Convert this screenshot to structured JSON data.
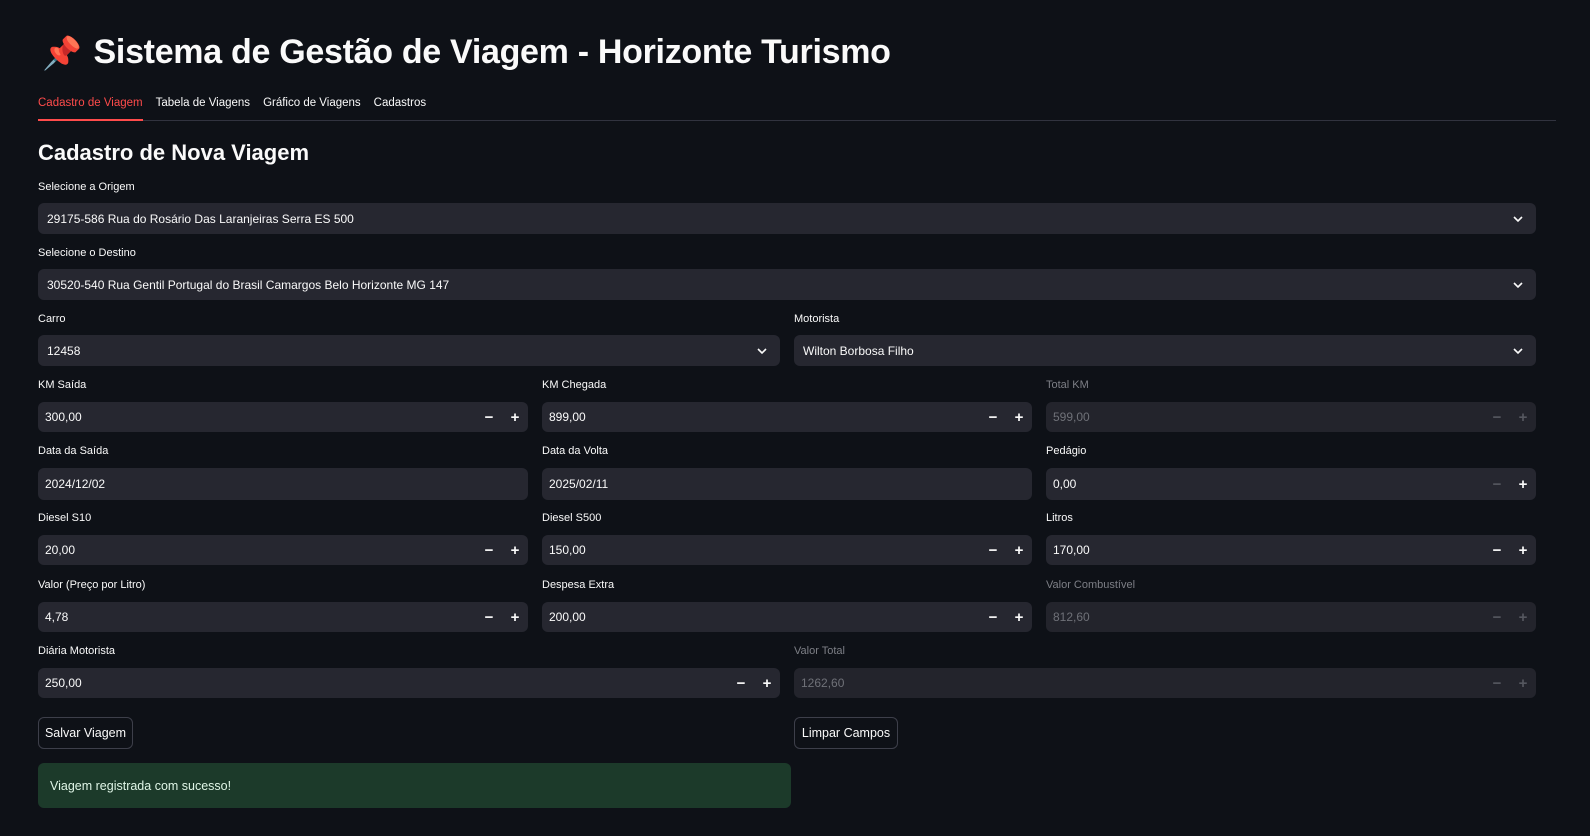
{
  "app": {
    "title_icon": "pushpin-icon",
    "title": "Sistema de Gestão de Viagem - Horizonte Turismo"
  },
  "tabs": [
    {
      "label": "Cadastro de Viagem",
      "active": true
    },
    {
      "label": "Tabela de Viagens",
      "active": false
    },
    {
      "label": "Gráfico de Viagens",
      "active": false
    },
    {
      "label": "Cadastros",
      "active": false
    }
  ],
  "form": {
    "heading": "Cadastro de Nova Viagem",
    "origem": {
      "label": "Selecione a Origem",
      "value": "29175-586 Rua do Rosário Das Laranjeiras Serra ES 500"
    },
    "destino": {
      "label": "Selecione o Destino",
      "value": "30520-540 Rua Gentil Portugal do Brasil Camargos Belo Horizonte MG 147"
    },
    "carro": {
      "label": "Carro",
      "value": "12458"
    },
    "motorista": {
      "label": "Motorista",
      "value": "Wilton Borbosa Filho"
    },
    "km_saida": {
      "label": "KM Saída",
      "value": "300,00"
    },
    "km_chegada": {
      "label": "KM Chegada",
      "value": "899,00"
    },
    "total_km": {
      "label": "Total KM",
      "value": "599,00",
      "disabled": true
    },
    "data_saida": {
      "label": "Data da Saída",
      "value": "2024/12/02"
    },
    "data_volta": {
      "label": "Data da Volta",
      "value": "2025/02/11"
    },
    "pedagio": {
      "label": "Pedágio",
      "value": "0,00"
    },
    "diesel_s10": {
      "label": "Diesel S10",
      "value": "20,00"
    },
    "diesel_s500": {
      "label": "Diesel S500",
      "value": "150,00"
    },
    "litros": {
      "label": "Litros",
      "value": "170,00"
    },
    "valor_litro": {
      "label": "Valor (Preço por Litro)",
      "value": "4,78"
    },
    "despesa_extra": {
      "label": "Despesa Extra",
      "value": "200,00"
    },
    "valor_combustivel": {
      "label": "Valor Combustível",
      "value": "812,60",
      "disabled": true
    },
    "diaria_motorista": {
      "label": "Diária Motorista",
      "value": "250,00"
    },
    "valor_total": {
      "label": "Valor Total",
      "value": "1262,60",
      "disabled": true
    }
  },
  "stepper": {
    "minus": "−",
    "plus": "+"
  },
  "buttons": {
    "save": "Salvar Viagem",
    "clear": "Limpar Campos"
  },
  "alert": {
    "message": "Viagem registrada com sucesso!",
    "color": "#1c3a2a"
  },
  "colors": {
    "accent": "#ff4b4b",
    "background": "#0e1117",
    "input": "#262730"
  }
}
